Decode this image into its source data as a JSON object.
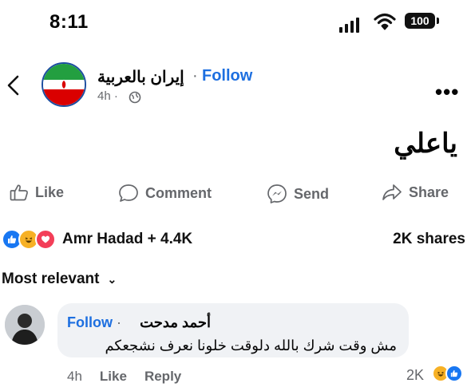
{
  "status_bar": {
    "time": "8:11",
    "battery": "100"
  },
  "post": {
    "page_name": "إيران بالعربية",
    "separator": "·",
    "follow_label": "Follow",
    "time": "4h ·",
    "text": "ياعلي",
    "actions": {
      "like": "Like",
      "comment": "Comment",
      "send": "Send",
      "share": "Share"
    },
    "reactors": "Amr Hadad + 4.4K",
    "shares": "2K shares",
    "sort_label": "Most relevant",
    "colors": {
      "accent": "#1d6fe0",
      "iran_green": "#239f40",
      "iran_red": "#da0000"
    }
  },
  "comment": {
    "author": "أحمد مدحت",
    "separator": "·",
    "follow_label": "Follow",
    "text": "مش وقت شرك بالله دلوقت خلونا نعرف نشجعكم",
    "time": "4h",
    "like_label": "Like",
    "reply_label": "Reply",
    "reaction_count": "2K"
  }
}
